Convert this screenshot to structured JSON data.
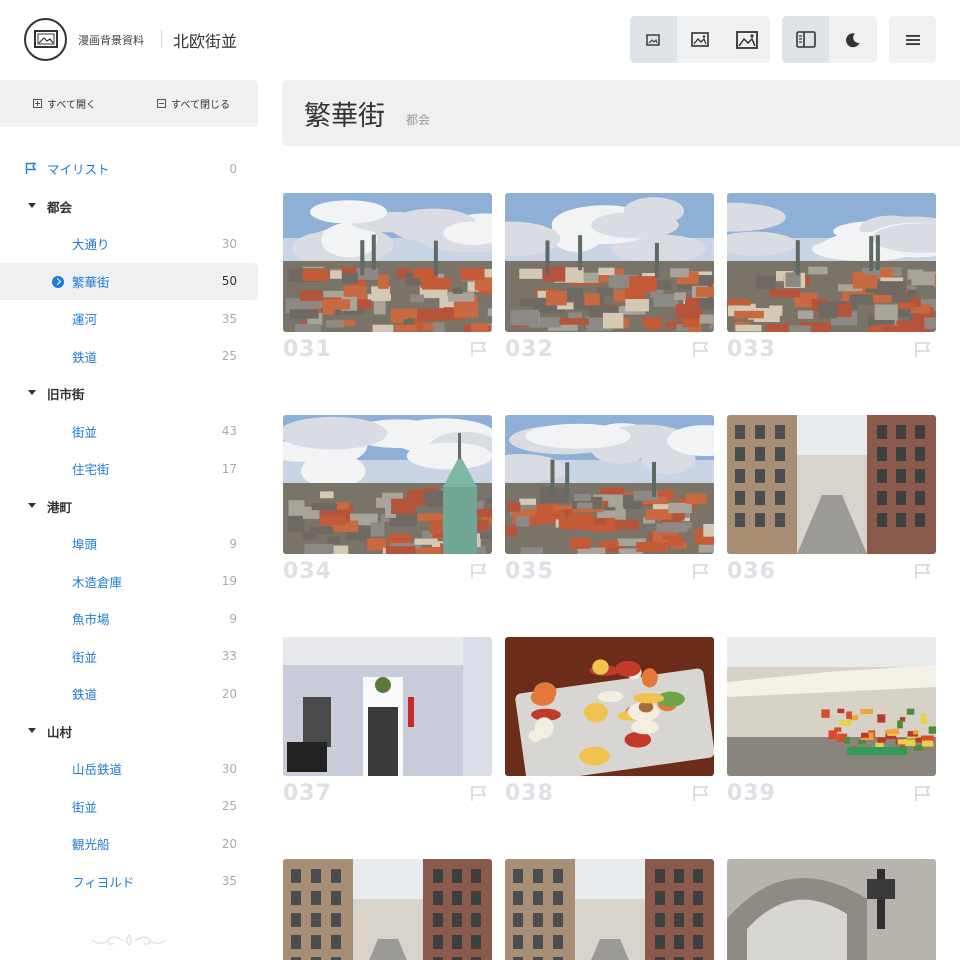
{
  "header": {
    "site_name": "漫画背景資料",
    "site_subtitle": "北欧街並"
  },
  "sidebar": {
    "expand_all": "すべて開く",
    "collapse_all": "すべて閉じる",
    "mylist": {
      "label": "マイリスト",
      "count": "0"
    },
    "categories": [
      {
        "label": "都会",
        "items": [
          {
            "label": "大通り",
            "count": "30"
          },
          {
            "label": "繁華街",
            "count": "50",
            "active": true
          },
          {
            "label": "運河",
            "count": "35"
          },
          {
            "label": "鉄道",
            "count": "25"
          }
        ]
      },
      {
        "label": "旧市街",
        "items": [
          {
            "label": "街並",
            "count": "43"
          },
          {
            "label": "住宅街",
            "count": "17"
          }
        ]
      },
      {
        "label": "港町",
        "items": [
          {
            "label": "埠頭",
            "count": "9"
          },
          {
            "label": "木造倉庫",
            "count": "19"
          },
          {
            "label": "魚市場",
            "count": "9"
          },
          {
            "label": "街並",
            "count": "33"
          },
          {
            "label": "鉄道",
            "count": "20"
          }
        ]
      },
      {
        "label": "山村",
        "items": [
          {
            "label": "山岳鉄道",
            "count": "30"
          },
          {
            "label": "街並",
            "count": "25"
          },
          {
            "label": "観光船",
            "count": "20"
          },
          {
            "label": "フィヨルド",
            "count": "35"
          }
        ]
      }
    ]
  },
  "main": {
    "title": "繁華街",
    "parent": "都会",
    "images": [
      {
        "number": "031",
        "scene": "rooftops"
      },
      {
        "number": "032",
        "scene": "rooftops"
      },
      {
        "number": "033",
        "scene": "rooftops"
      },
      {
        "number": "034",
        "scene": "tower"
      },
      {
        "number": "035",
        "scene": "rooftops"
      },
      {
        "number": "036",
        "scene": "street"
      },
      {
        "number": "037",
        "scene": "facade"
      },
      {
        "number": "038",
        "scene": "food"
      },
      {
        "number": "039",
        "scene": "market"
      },
      {
        "number": "",
        "scene": "street"
      },
      {
        "number": "",
        "scene": "street"
      },
      {
        "number": "",
        "scene": "arch"
      }
    ]
  },
  "colors": {
    "accent": "#1f7bd6",
    "panel": "#eef0f2",
    "number": "#dde0e4"
  },
  "icons": [
    "logo-icon",
    "image-small-icon",
    "image-medium-icon",
    "image-large-icon",
    "sidebar-layout-icon",
    "moon-icon",
    "hamburger-menu-icon",
    "flag-icon",
    "expand-icon",
    "collapse-icon",
    "chevron-circle-icon",
    "ornament-icon"
  ]
}
